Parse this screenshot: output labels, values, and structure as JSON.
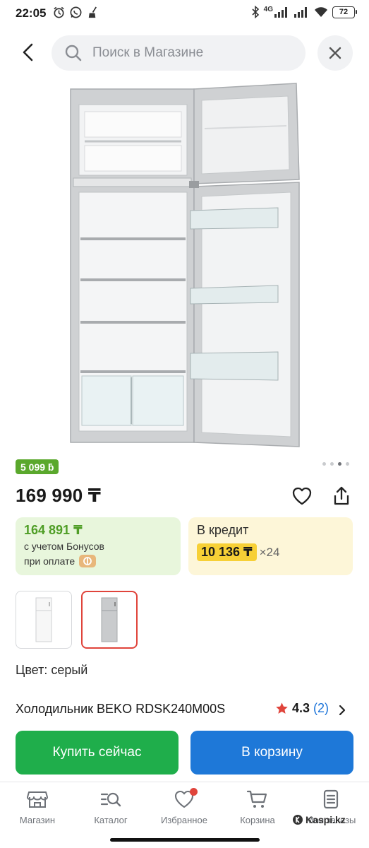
{
  "status_bar": {
    "time": "22:05",
    "network": "4G",
    "battery": "72"
  },
  "header": {
    "search_placeholder": "Поиск в Магазине"
  },
  "product": {
    "bonus_badge": "5 099 ƃ",
    "price": "169 990 ₸",
    "bonus_price": "164 891 ₸",
    "bonus_line1": "с учетом Бонусов",
    "bonus_line2": "при оплате",
    "credit_title": "В кредит",
    "credit_amount": "10 136 ₸",
    "credit_term": "×24",
    "color_label": "Цвет: серый",
    "title": "Холодильник BEKO RDSK240M00S",
    "rating": "4.3",
    "review_count": "(2)",
    "images_total": 4,
    "image_active_index": 3
  },
  "actions": {
    "buy_now": "Купить сейчас",
    "add_to_cart": "В корзину"
  },
  "nav": {
    "items": [
      {
        "label": "Магазин",
        "icon": "shop-icon"
      },
      {
        "label": "Каталог",
        "icon": "catalog-icon"
      },
      {
        "label": "Избранное",
        "icon": "heart-icon"
      },
      {
        "label": "Корзина",
        "icon": "cart-icon"
      },
      {
        "label": "Мои заказы",
        "icon": "orders-icon"
      }
    ]
  },
  "watermark": "Kaspi.kz",
  "colors": {
    "green": "#1fae4b",
    "blue": "#1e78d8",
    "red": "#e0443b",
    "yellow": "#f7d036"
  }
}
